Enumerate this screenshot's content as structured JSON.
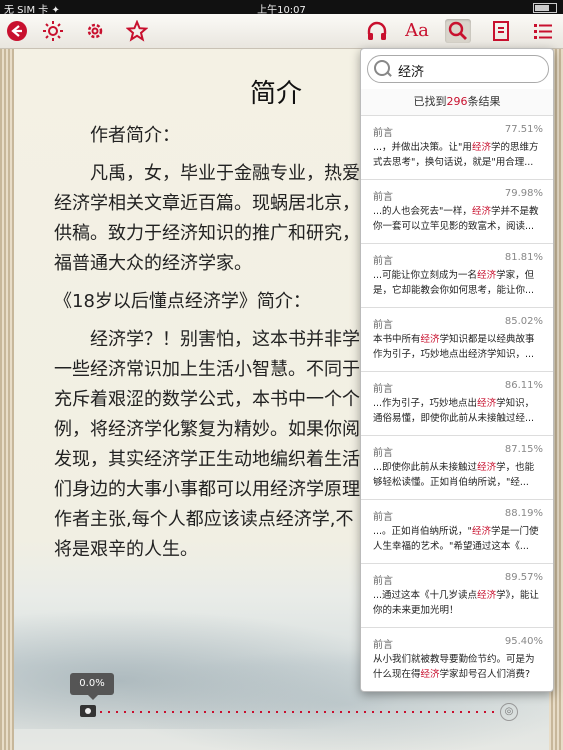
{
  "status": {
    "carrier": "无 SIM 卡 ✦",
    "time": "上午10:07"
  },
  "toolbar": {
    "back_icon": "back-arrow-icon",
    "brightness_down_icon": "sun-icon",
    "settings_icon": "gear-icon",
    "bookmark_star_icon": "star-icon",
    "audio_icon": "headphones-icon",
    "font_label": "Aa",
    "search_icon": "search-icon",
    "bookmarks_icon": "bookmark-icon",
    "toc_icon": "list-icon"
  },
  "page": {
    "title": "简介",
    "lines": [
      "作者简介：",
      "凡禹，女，毕业于金融专业，热爱",
      "经济学相关文章近百篇。现蜗居北京，",
      "供稿。致力于经济知识的推广和研究，",
      "福普通大众的经济学家。",
      "《18岁以后懂点经济学》简介：",
      "经济学？！别害怕，这本书并非学",
      "一些经济常识加上生活小智慧。不同于",
      "充斥着艰涩的数学公式，本书中一个个",
      "例，将经济学化繁复为精妙。如果你阅",
      "发现，其实经济学正生动地编织着生活",
      "们身边的大事小事都可以用经济学原理",
      "作者主张,每个人都应该读点经济学,不",
      "将是艰辛的人生。"
    ]
  },
  "progress": {
    "label": "0.0%",
    "value": 0.0
  },
  "search": {
    "query": "经济",
    "found_prefix": "已找到",
    "found_count": "296",
    "found_suffix": "条结果",
    "results": [
      {
        "chapter": "前言",
        "percent": "77.51%",
        "pre": "...，并做出决策。让\"用",
        "hit": "经济",
        "post": "学的思维方式去思考\"，换句话说，就是\"用合理..."
      },
      {
        "chapter": "前言",
        "percent": "79.98%",
        "pre": "...的人也会死去\"一样，",
        "hit": "经济",
        "post": "学并不是教你一套可以立竿见影的致富术，阅读..."
      },
      {
        "chapter": "前言",
        "percent": "81.81%",
        "pre": "...可能让你立刻成为一名",
        "hit": "经济",
        "post": "学家，但是，它却能教会你如何思考，能让你..."
      },
      {
        "chapter": "前言",
        "percent": "85.02%",
        "pre": "本书中所有",
        "hit": "经济",
        "post": "学知识都是以经典故事作为引子，巧妙地点出经济学知识，..."
      },
      {
        "chapter": "前言",
        "percent": "86.11%",
        "pre": "...作为引子，巧妙地点出",
        "hit": "经济",
        "post": "学知识，通俗易懂，即使你此前从未接触过经..."
      },
      {
        "chapter": "前言",
        "percent": "87.15%",
        "pre": "...即使你此前从未接触过",
        "hit": "经济",
        "post": "学，也能够轻松读懂。正如肖伯纳所说，\"经..."
      },
      {
        "chapter": "前言",
        "percent": "88.19%",
        "pre": "...。正如肖伯纳所说，\"",
        "hit": "经济",
        "post": "学是一门使人生幸福的艺术。\"希望通过这本《..."
      },
      {
        "chapter": "前言",
        "percent": "89.57%",
        "pre": "...通过这本《十几岁读点",
        "hit": "经济",
        "post": "学》，能让你的未来更加光明！"
      },
      {
        "chapter": "前言",
        "percent": "95.40%",
        "pre": "从小我们就被教导要勤俭节约。可是为什么现在得",
        "hit": "经济",
        "post": "学家却号召人们消费?"
      }
    ]
  }
}
